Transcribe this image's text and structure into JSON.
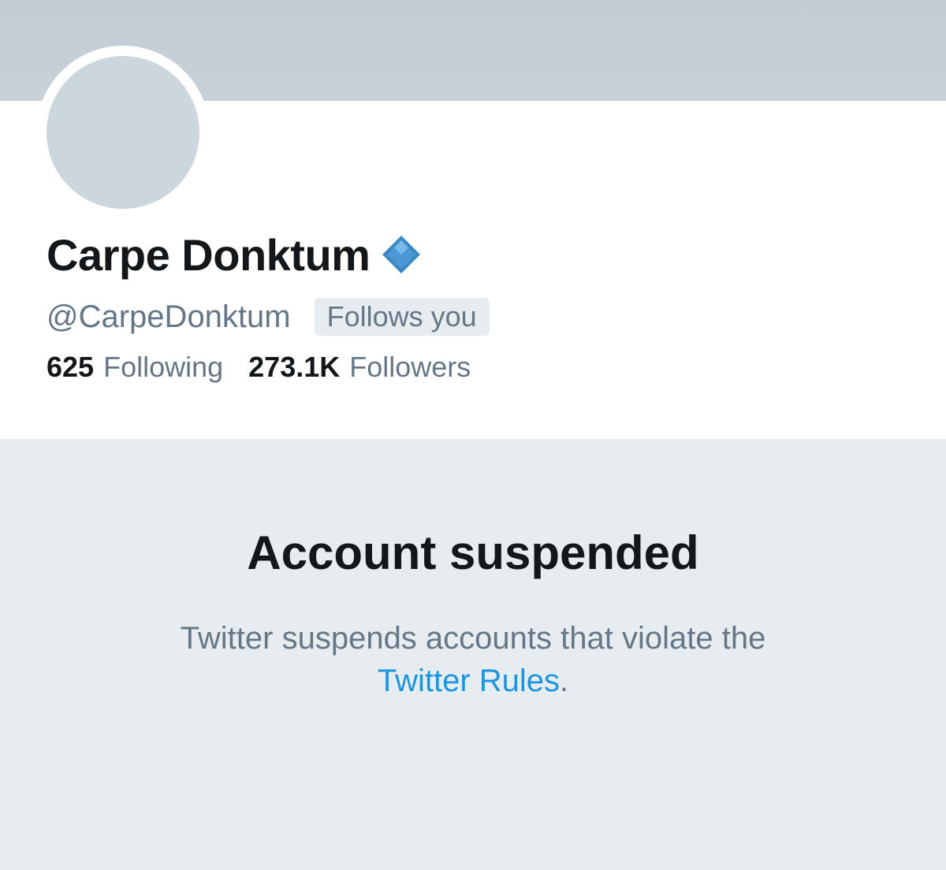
{
  "profile": {
    "display_name": "Carpe Donktum",
    "handle": "@CarpeDonktum",
    "follows_you_label": "Follows you",
    "badge_icon": "blue-diamond-icon",
    "following_count": "625",
    "following_label": "Following",
    "followers_count": "273.1K",
    "followers_label": "Followers"
  },
  "suspension": {
    "title": "Account suspended",
    "message": "Twitter suspends accounts that violate the",
    "link_text": "Twitter Rules",
    "trailing_punctuation": "."
  },
  "colors": {
    "banner": "#c6ced6",
    "avatar_placeholder": "#ccd6dd",
    "suspended_background": "#e6ecf0",
    "link": "#1b95e0",
    "badge": "#3b88c3"
  }
}
